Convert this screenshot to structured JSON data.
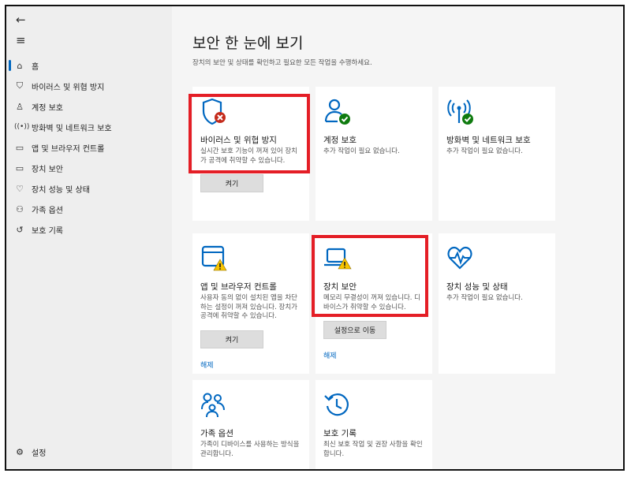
{
  "nav": {
    "back_glyph": "←",
    "menu_glyph": "≡",
    "items": [
      {
        "label": "홈",
        "icon": "home-icon"
      },
      {
        "label": "바이러스 및 위협 방지",
        "icon": "shield-icon"
      },
      {
        "label": "계정 보호",
        "icon": "person-icon"
      },
      {
        "label": "방화벽 및 네트워크 보호",
        "icon": "antenna-icon"
      },
      {
        "label": "앱 및 브라우저 컨트롤",
        "icon": "browser-icon"
      },
      {
        "label": "장치 보안",
        "icon": "laptop-icon"
      },
      {
        "label": "장치 성능 및 상태",
        "icon": "heart-icon"
      },
      {
        "label": "가족 옵션",
        "icon": "family-icon"
      },
      {
        "label": "보호 기록",
        "icon": "history-icon"
      }
    ],
    "settings_label": "설정"
  },
  "main": {
    "title": "보안 한 눈에 보기",
    "subtitle": "장치의 보안 및 상태를 확인하고 필요한 모든 작업을 수행하세요."
  },
  "cards": {
    "virus": {
      "title": "바이러스 및 위협 방지",
      "desc": "실시간 보호 기능이 꺼져 있어 장치가 공격에 취약할 수 있습니다.",
      "button": "켜기"
    },
    "account": {
      "title": "계정 보호",
      "desc": "추가 작업이 필요 없습니다."
    },
    "firewall": {
      "title": "방화벽 및 네트워크 보호",
      "desc": "추가 작업이 필요 없습니다."
    },
    "app": {
      "title": "앱 및 브라우저 컨트롤",
      "desc": "사용자 동의 없이 설치된 앱을 차단하는 설정이 꺼져 있습니다. 장치가 공격에 취약할 수 있습니다.",
      "button": "켜기",
      "link": "해제"
    },
    "device_security": {
      "title": "장치 보안",
      "desc": "메모리 무결성이 꺼져 있습니다. 디바이스가 취약할 수 있습니다.",
      "button": "설정으로 이동",
      "link": "해제"
    },
    "performance": {
      "title": "장치 성능 및 상태",
      "desc": "추가 작업이 필요 없습니다."
    },
    "family": {
      "title": "가족 옵션",
      "desc": "가족이 디바이스를 사용하는 방식을 관리합니다."
    },
    "history": {
      "title": "보호 기록",
      "desc": "최신 보호 작업 및 권장 사항을 확인합니다."
    }
  },
  "colors": {
    "accent": "#0067c0",
    "ok": "#0f7b0f",
    "warn": "#f7c400",
    "error": "#c42b1c",
    "highlight": "#e41e26"
  }
}
